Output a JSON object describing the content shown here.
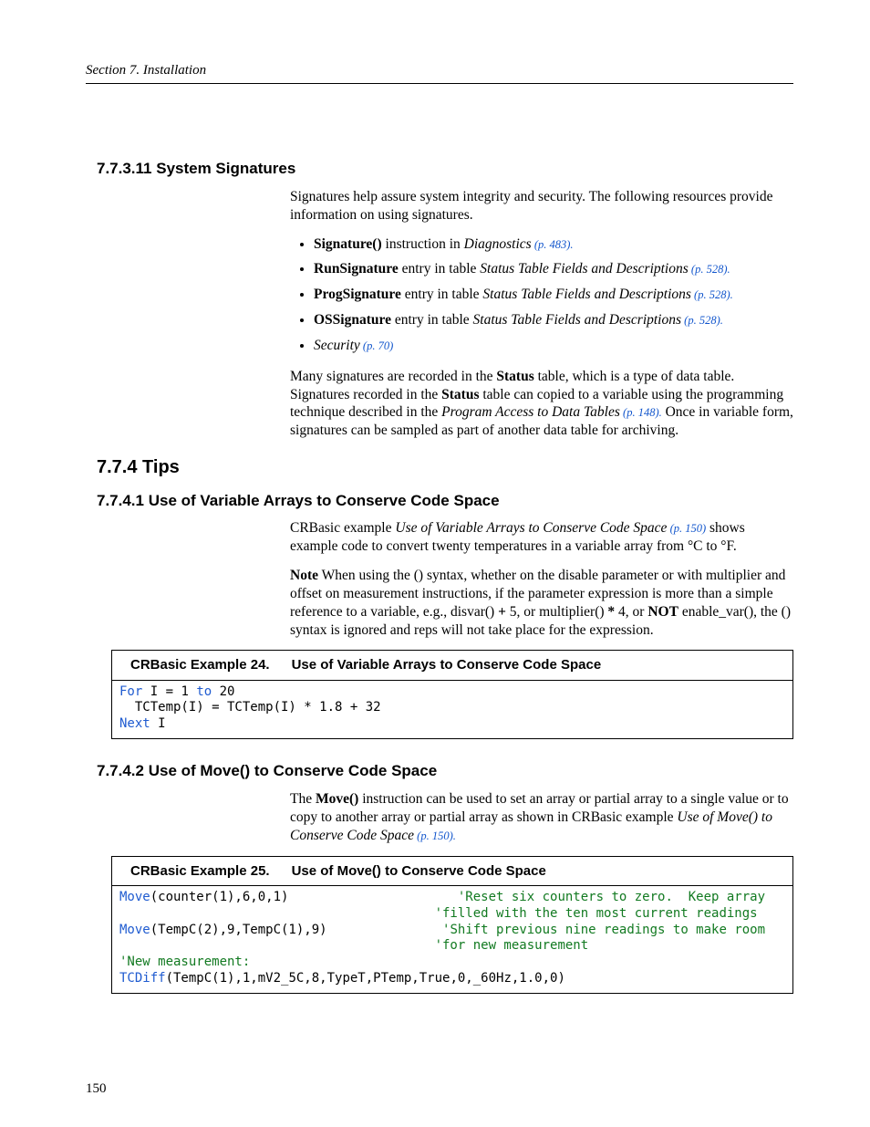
{
  "header": {
    "running": "Section 7.  Installation"
  },
  "sec_sys_sig": {
    "title": "7.7.3.11 System Signatures",
    "intro": "Signatures help assure system integrity and security.  The following resources provide information on using signatures.",
    "bullets": [
      {
        "b": "Signature()",
        "mid": " instruction in ",
        "i": "Diagnostics",
        "lnk": " (p. 483)."
      },
      {
        "b": "RunSignature",
        "mid": " entry in table ",
        "i": "Status Table Fields and Descriptions",
        "lnk": " (p. 528)."
      },
      {
        "b": "ProgSignature",
        "mid": " entry in table ",
        "i": "Status Table Fields and Descriptions",
        "lnk": " (p. 528)."
      },
      {
        "b": "OSSignature",
        "mid": " entry in table ",
        "i": "Status Table Fields and Descriptions",
        "lnk": " (p. 528)."
      },
      {
        "i_only": "Security",
        "lnk": " (p. 70)"
      }
    ],
    "after1a": "Many signatures are recorded in the ",
    "after1b": "Status",
    "after1c": " table, which is a type of data table. Signatures recorded in the ",
    "after1d": "Status",
    "after1e": " table can copied to a variable using the programming technique described in the ",
    "after1f": "Program Access to Data Tables",
    "after1g": " (p. 148).",
    "after2": " Once in variable form, signatures can be sampled as part of another data table for archiving."
  },
  "tips_title": "7.7.4 Tips",
  "sec_var_arr": {
    "title": "7.7.4.1 Use of Variable Arrays to Conserve Code Space",
    "p1a": "CRBasic example ",
    "p1b": "Use of Variable Arrays to Conserve Code Space",
    "p1c": " (p. 150)",
    "p1d": " shows example code to convert twenty temperatures in a variable array from °C to °F.",
    "note_lead": "Note",
    "note1": "  When using the () syntax, whether on the disable parameter or with multiplier and offset on measurement instructions, if the parameter expression is more than a simple reference to a variable, e.g., disvar() ",
    "note_plus": "+",
    "note2": " 5, or multiplier() ",
    "note_star": "*",
    "note3": " 4, or ",
    "note_not": "NOT",
    "note4": " enable_var(), the () syntax is ignored and reps will not take place for the expression."
  },
  "example24": {
    "label": "CRBasic Example 24.",
    "title": "Use of Variable Arrays to Conserve Code Space",
    "code": {
      "l1a": "For",
      "l1b": " I = 1 ",
      "l1c": "to",
      "l1d": " 20",
      "l2": "  TCTemp(I) = TCTemp(I) * 1.8 + 32",
      "l3a": "Next",
      "l3b": " I"
    }
  },
  "sec_move": {
    "title": "7.7.4.2 Use of Move() to Conserve Code Space",
    "p1a": "The ",
    "p1b": "Move()",
    "p1c": " instruction can be used to set an array or partial array to a single value or to copy to another array or partial array as shown in CRBasic example ",
    "p1d": "Use of Move() to Conserve Code Space",
    "p1e": " (p. 150)."
  },
  "example25": {
    "label": "CRBasic Example 25.",
    "title": "Use of Move() to Conserve Code Space",
    "code": {
      "l1a": "Move",
      "l1b": "(counter(1),6,0,1)",
      "l1c": "'Reset six counters to zero.  Keep array",
      "l1d": "'filled with the ten most current readings",
      "l2a": "Move",
      "l2b": "(TempC(2),9,TempC(1),9)",
      "l2c": "'Shift previous nine readings to make room",
      "l2d": "'for new measurement",
      "l3": "'New measurement:",
      "l4a": "TCDiff",
      "l4b": "(TempC(1),1,mV2_5C,8,TypeT,PTemp,True,0,_60Hz,1.0,0)"
    }
  },
  "page_number": "150"
}
